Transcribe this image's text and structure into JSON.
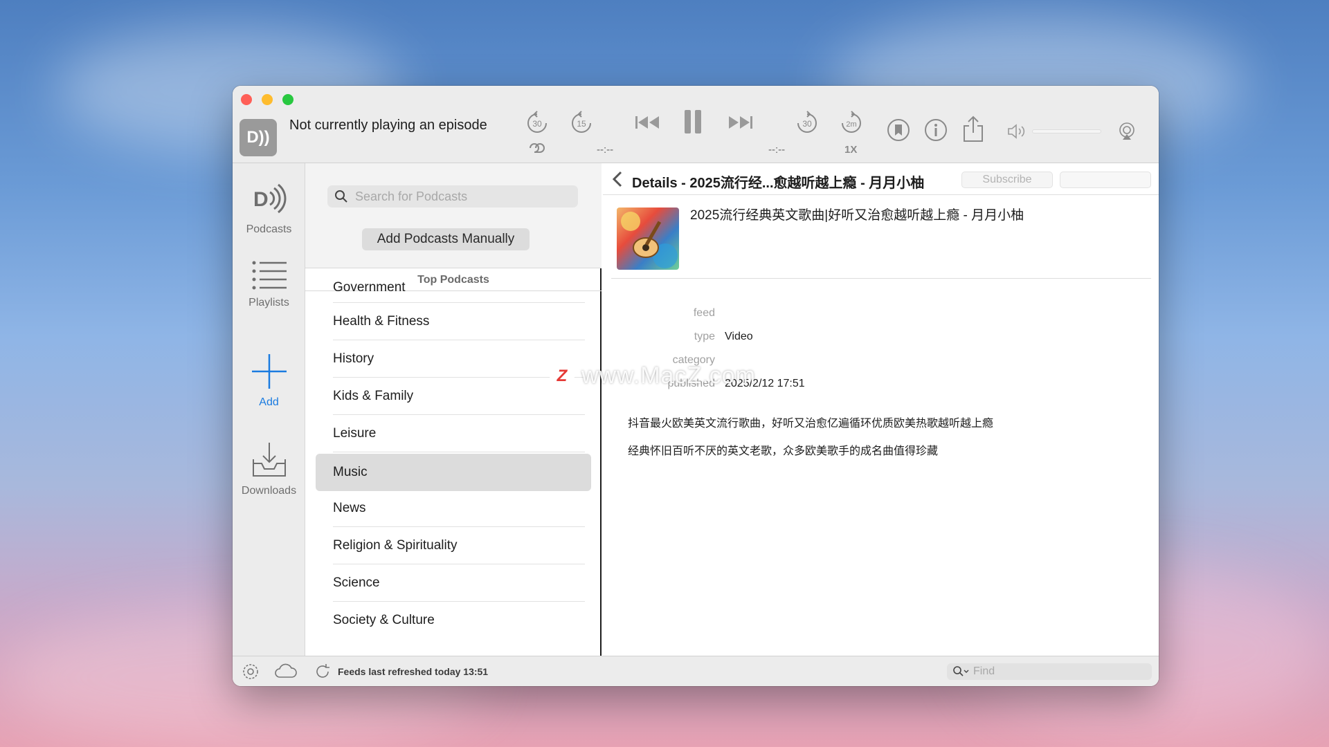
{
  "player": {
    "status": "Not currently playing an episode",
    "app_icon_label": "D))",
    "time_left": "--:--",
    "time_right": "--:--",
    "speed": "1X",
    "skip_back_1": "30",
    "skip_back_2": "15",
    "skip_fwd_1": "30",
    "skip_fwd_2": "2m"
  },
  "sidebar": {
    "items": [
      {
        "label": "Podcasts",
        "icon": "podcast-logo-icon"
      },
      {
        "label": "Playlists",
        "icon": "list-icon"
      },
      {
        "label": "Add",
        "icon": "plus-icon"
      },
      {
        "label": "Downloads",
        "icon": "download-tray-icon"
      }
    ]
  },
  "middle": {
    "search_placeholder": "Search for Podcasts",
    "add_manually": "Add Podcasts Manually",
    "top_title": "Top Podcasts",
    "categories": [
      {
        "label": "Government",
        "selected": false
      },
      {
        "label": "Health & Fitness",
        "selected": false
      },
      {
        "label": "History",
        "selected": false
      },
      {
        "label": "Kids & Family",
        "selected": false
      },
      {
        "label": "Leisure",
        "selected": false
      },
      {
        "label": "Music",
        "selected": true
      },
      {
        "label": "News",
        "selected": false
      },
      {
        "label": "Religion & Spirituality",
        "selected": false
      },
      {
        "label": "Science",
        "selected": false
      },
      {
        "label": "Society & Culture",
        "selected": false
      }
    ]
  },
  "detail": {
    "title": "Details - 2025流行经...愈越听越上瘾 - 月月小柚",
    "subscribe": "Subscribe",
    "episode_title": "2025流行经典英文歌曲|好听又治愈越听越上瘾 - 月月小柚",
    "meta": {
      "feed_key": "feed",
      "feed_val": "",
      "type_key": "type",
      "type_val": "Video",
      "category_key": "category",
      "category_val": "",
      "published_key": "published",
      "published_val": "2025/2/12 17:51"
    },
    "description_lines": [
      "抖音最火欧美英文流行歌曲，好听又治愈亿遍循环优质欧美热歌越听越上瘾",
      "经典怀旧百听不厌的英文老歌，众多欧美歌手的成名曲值得珍藏"
    ],
    "watermark": "www.MacZ.com",
    "watermark_badge": "Z"
  },
  "statusbar": {
    "refresh_text": "Feeds last refreshed today 13:51",
    "find_placeholder": "Find"
  },
  "colors": {
    "accent": "#1a7be0",
    "close": "#ff5f57",
    "minimize": "#febc2e",
    "zoom": "#28c840"
  }
}
